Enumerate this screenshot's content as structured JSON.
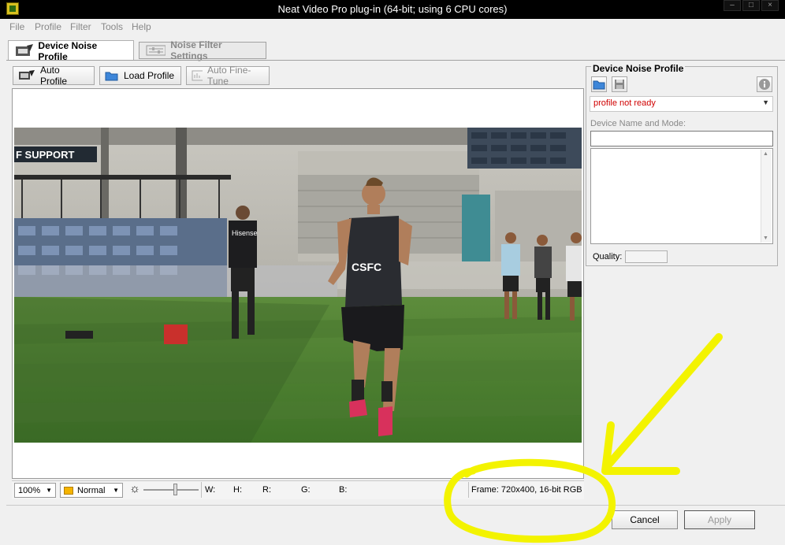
{
  "window": {
    "title": "Neat Video Pro plug-in (64-bit; using 6 CPU cores)"
  },
  "menu": [
    "File",
    "Profile",
    "Filter",
    "Tools",
    "Help"
  ],
  "tabs": [
    {
      "label": "Device Noise Profile",
      "active": true
    },
    {
      "label": "Noise Filter Settings",
      "active": false
    }
  ],
  "toolbar": {
    "auto_profile": "Auto Profile",
    "load_profile": "Load Profile",
    "auto_finetune": "Auto Fine-Tune"
  },
  "preview": {
    "jersey_text": "CSFC",
    "banner_text": "F SUPPORT",
    "sponsor_text": "Hisense"
  },
  "statusbar": {
    "zoom": "100%",
    "mode": "Normal",
    "w_label": "W:",
    "h_label": "H:",
    "r_label": "R:",
    "g_label": "G:",
    "b_label": "B:",
    "frame_info": "Frame: 720x400, 16-bit RGB"
  },
  "right_panel": {
    "title": "Device Noise Profile",
    "profile_status": "profile not ready",
    "device_name_label": "Device Name and Mode:",
    "quality_label": "Quality:"
  },
  "buttons": {
    "cancel": "Cancel",
    "apply": "Apply"
  },
  "colors": {
    "annotation": "#f3f300",
    "status_error": "#d00000"
  }
}
